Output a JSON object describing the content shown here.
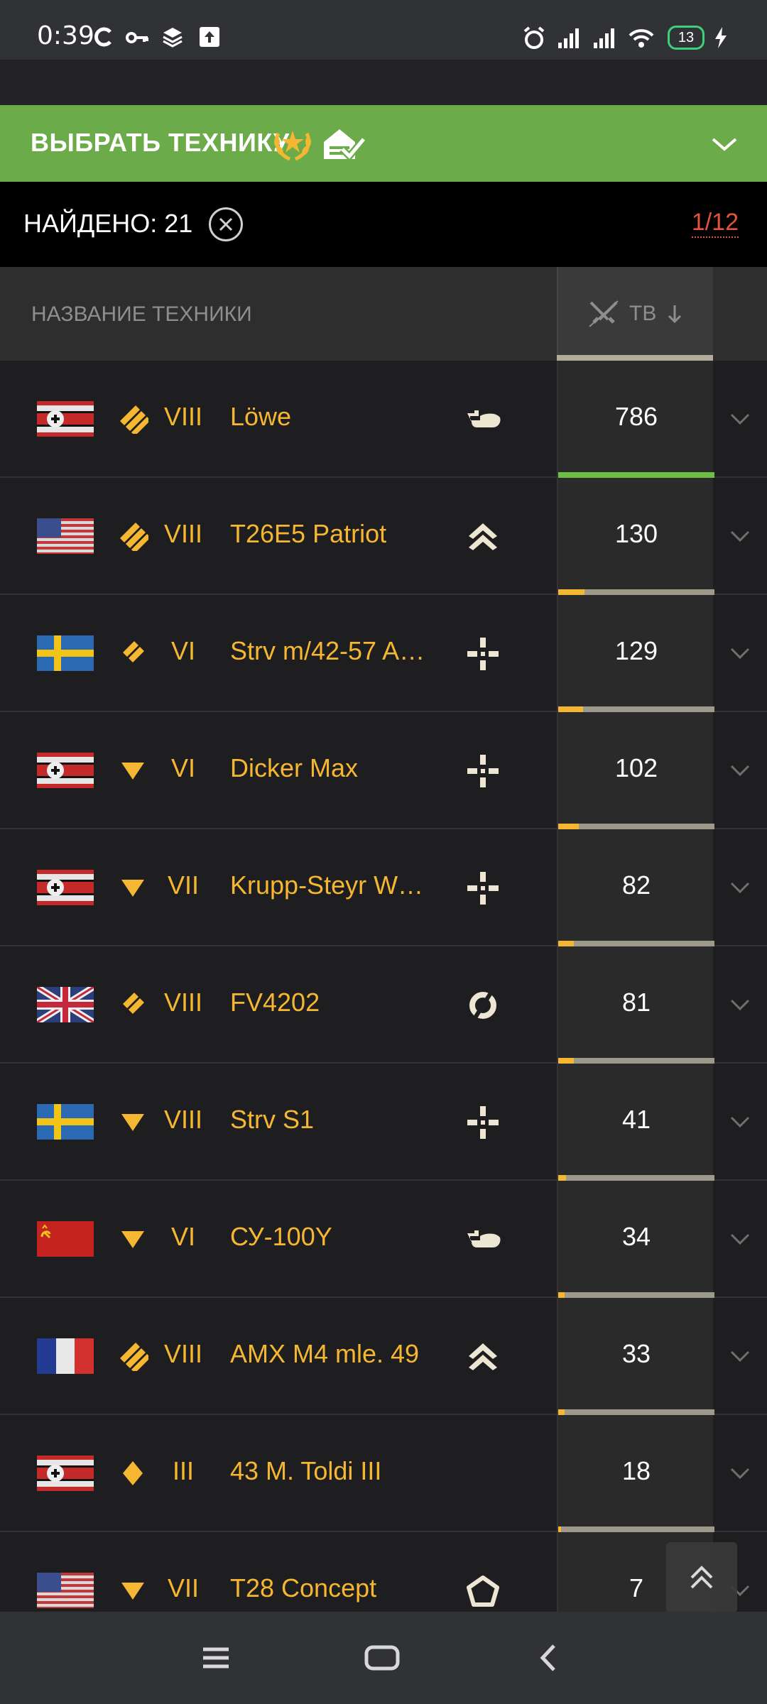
{
  "status_bar": {
    "time": "0:39",
    "battery": "13",
    "icons": [
      "sync-icon",
      "key-icon",
      "layers-icon",
      "upload-icon",
      "alarm-icon",
      "signal-icon",
      "signal-icon",
      "wifi-icon",
      "battery-icon",
      "charging-icon"
    ]
  },
  "header": {
    "title": "ВЫБРАТЬ ТЕХНИКУ",
    "color": "#6cab4a"
  },
  "search": {
    "found_label": "НАЙДЕНО: 21",
    "page": "1/12"
  },
  "columns": {
    "name": "НАЗВАНИЕ ТЕХНИКИ",
    "tb": "ТВ"
  },
  "vehicles": [
    {
      "flag": "germany",
      "type": "heavy",
      "tier": "VIII",
      "name": "Löwe",
      "role": "assault-heavy-icon",
      "tb": "786",
      "bar": 1.0
    },
    {
      "flag": "usa",
      "type": "heavy",
      "tier": "VIII",
      "name": "T26E5 Patriot",
      "role": "versatile-icon",
      "tb": "130",
      "bar": 0.17
    },
    {
      "flag": "sweden",
      "type": "medium",
      "tier": "VI",
      "name": "Strv m/42-57 A…",
      "role": "sniper-icon",
      "tb": "129",
      "bar": 0.16
    },
    {
      "flag": "germany",
      "type": "td",
      "tier": "VI",
      "name": "Dicker Max",
      "role": "sniper-icon",
      "tb": "102",
      "bar": 0.13
    },
    {
      "flag": "germany",
      "type": "td",
      "tier": "VII",
      "name": "Krupp-Steyr W…",
      "role": "sniper-icon",
      "tb": "82",
      "bar": 0.1
    },
    {
      "flag": "uk",
      "type": "medium",
      "tier": "VIII",
      "name": "FV4202",
      "role": "support-icon",
      "tb": "81",
      "bar": 0.1
    },
    {
      "flag": "sweden",
      "type": "td",
      "tier": "VIII",
      "name": "Strv S1",
      "role": "sniper-icon",
      "tb": "41",
      "bar": 0.05
    },
    {
      "flag": "ussr",
      "type": "td",
      "tier": "VI",
      "name": "СУ-100Y",
      "role": "assault-heavy-icon",
      "tb": "34",
      "bar": 0.04
    },
    {
      "flag": "france",
      "type": "heavy",
      "tier": "VIII",
      "name": "AMX M4 mle. 49",
      "role": "versatile-icon",
      "tb": "33",
      "bar": 0.04
    },
    {
      "flag": "germany",
      "type": "light",
      "tier": "III",
      "name": "43 M. Toldi III",
      "role": "",
      "tb": "18",
      "bar": 0.02
    },
    {
      "flag": "usa",
      "type": "td",
      "tier": "VII",
      "name": "T28 Concept",
      "role": "pentagon-icon",
      "tb": "7",
      "bar": 0.01
    }
  ]
}
